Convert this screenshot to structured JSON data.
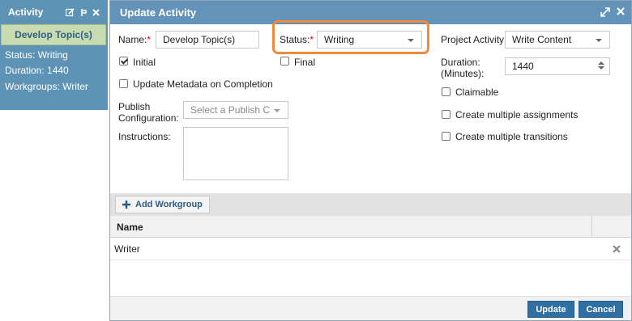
{
  "side_panel": {
    "title": "Activity",
    "card_title": "Develop Topic(s)",
    "status_line": "Status: Writing",
    "duration_line": "Duration: 1440",
    "workgroups_line": "Workgroups: Writer",
    "icons": [
      "edit-icon",
      "branch-icon",
      "close-icon"
    ]
  },
  "dialog": {
    "title": "Update Activity",
    "header_icons": [
      "expand-icon",
      "close-icon"
    ],
    "name": {
      "label": "Name:",
      "required_mark": "*",
      "value": "Develop Topic(s)"
    },
    "status": {
      "label": "Status:",
      "required_mark": "*",
      "value": "Writing"
    },
    "project_activity": {
      "label": "Project Activity:",
      "value": "Write Content"
    },
    "initial": {
      "label": "Initial",
      "checked": true
    },
    "final": {
      "label": "Final",
      "checked": false
    },
    "duration": {
      "label_line1": "Duration:",
      "label_line2": "(Minutes):",
      "value": "1440"
    },
    "update_metadata": {
      "label": "Update Metadata on Completion",
      "checked": false
    },
    "claimable": {
      "label": "Claimable",
      "checked": false
    },
    "publish_config": {
      "label_line1": "Publish",
      "label_line2": "Configuration:",
      "placeholder": "Select a Publish Co"
    },
    "create_multiple_assignments": {
      "label": "Create multiple assignments",
      "checked": false
    },
    "create_multiple_transitions": {
      "label": "Create multiple transitions",
      "checked": false
    },
    "instructions": {
      "label": "Instructions:",
      "value": ""
    },
    "add_workgroup_label": "Add Workgroup",
    "grid": {
      "columns": [
        "Name"
      ],
      "rows": [
        {
          "name": "Writer"
        }
      ]
    },
    "buttons": {
      "update": "Update",
      "cancel": "Cancel"
    },
    "highlight_color": "#f08a3c",
    "header_color": "#6393b8"
  }
}
